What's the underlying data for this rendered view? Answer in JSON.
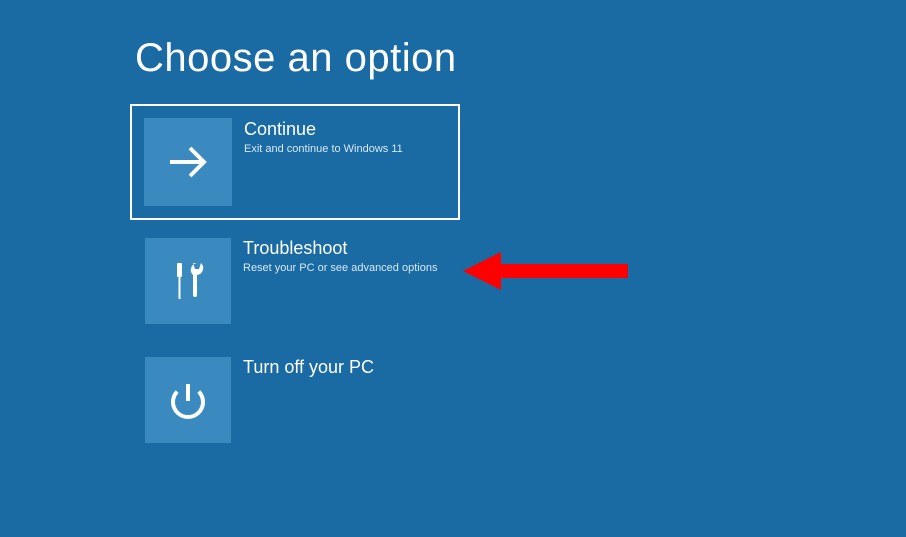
{
  "title": "Choose an option",
  "options": [
    {
      "id": "continue",
      "title": "Continue",
      "subtitle": "Exit and continue to Windows 11",
      "icon": "arrow-right",
      "selected": true
    },
    {
      "id": "troubleshoot",
      "title": "Troubleshoot",
      "subtitle": "Reset your PC or see advanced options",
      "icon": "tools",
      "selected": false
    },
    {
      "id": "turnoff",
      "title": "Turn off your PC",
      "subtitle": "",
      "icon": "power",
      "selected": false
    }
  ],
  "annotation": {
    "arrow_color": "#ff0000",
    "target": "troubleshoot"
  }
}
